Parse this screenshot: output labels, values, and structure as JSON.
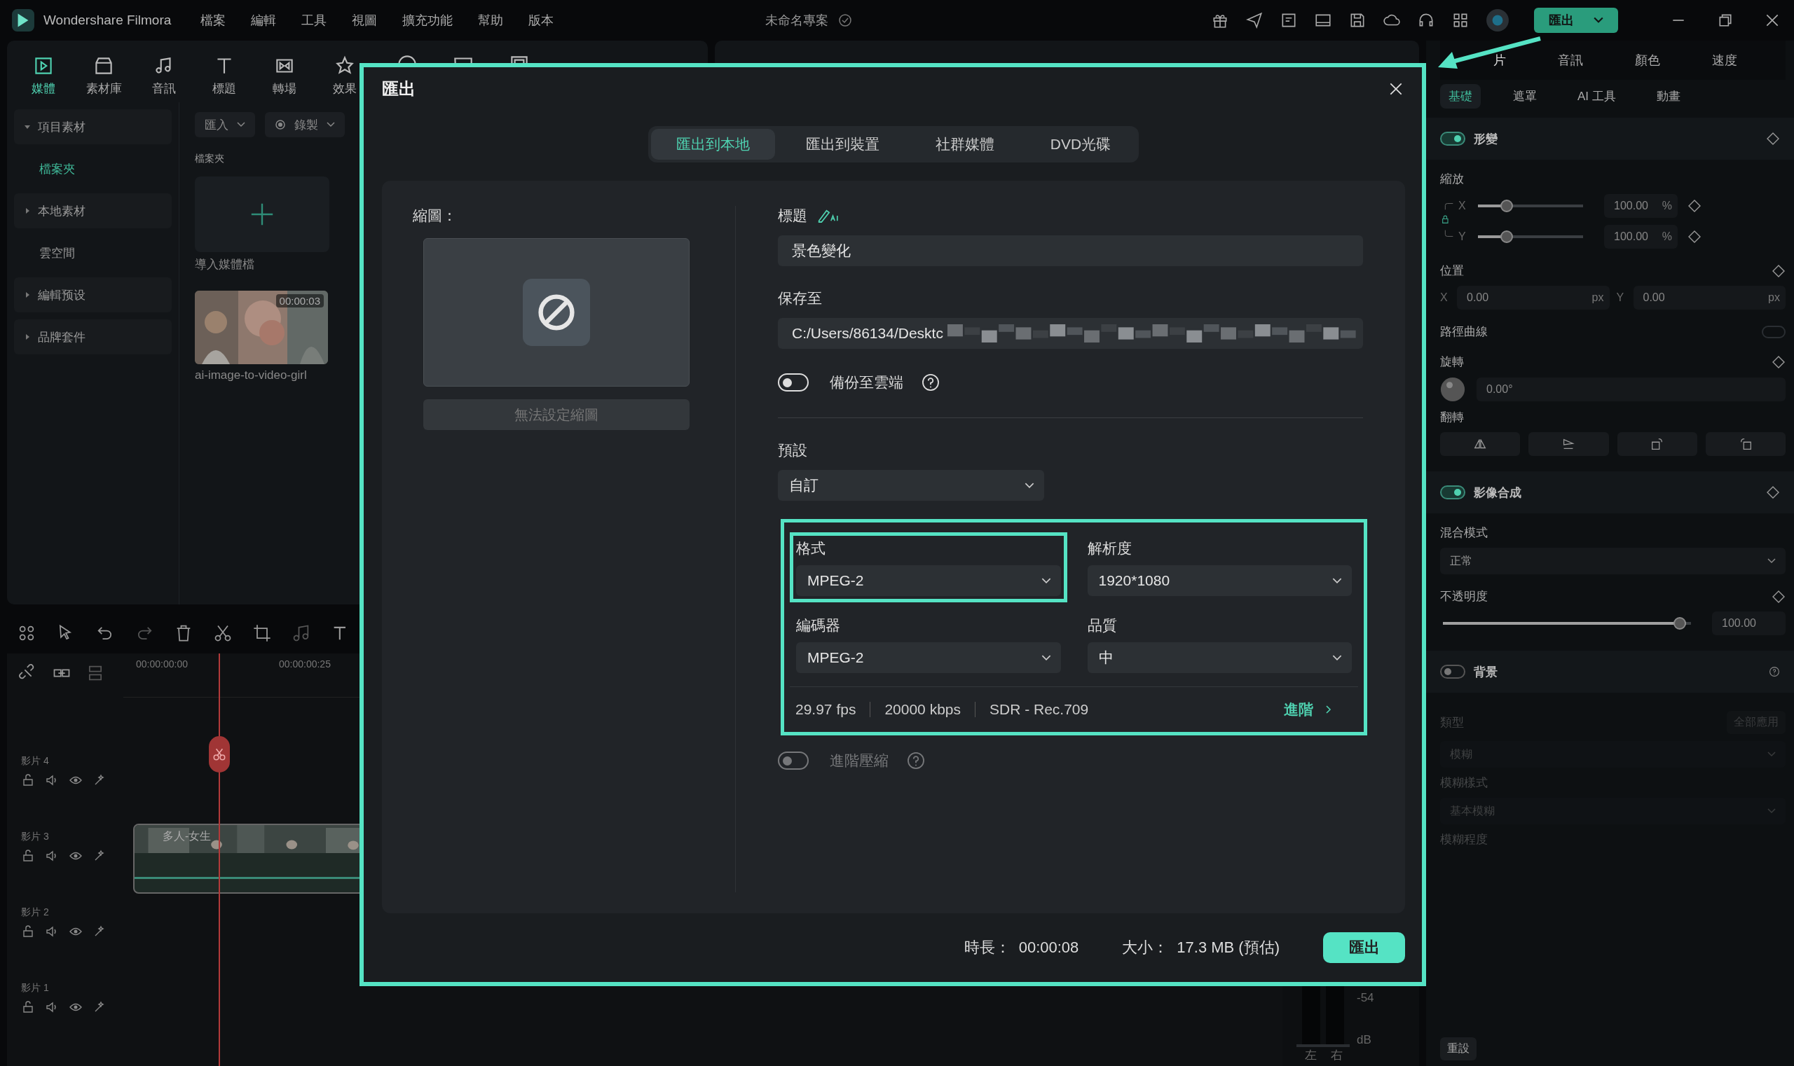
{
  "app": {
    "name": "Wondershare Filmora",
    "project_title": "未命名專案",
    "export_button": "匯出"
  },
  "menu": [
    "檔案",
    "編輯",
    "工具",
    "視圖",
    "擴充功能",
    "幫助",
    "版本"
  ],
  "toolbar": [
    {
      "label": "媒體",
      "selected": true
    },
    {
      "label": "素材庫",
      "selected": false
    },
    {
      "label": "音訊",
      "selected": false
    },
    {
      "label": "標題",
      "selected": false
    },
    {
      "label": "轉場",
      "selected": false
    },
    {
      "label": "效果",
      "selected": false
    }
  ],
  "media_nav": [
    {
      "label": "項目素材",
      "kind": "group",
      "expanded": true,
      "selected": false
    },
    {
      "label": "檔案夾",
      "kind": "leaf",
      "selected": true
    },
    {
      "label": "本地素材",
      "kind": "group",
      "expanded": false,
      "selected": false
    },
    {
      "label": "雲空間",
      "kind": "leaf",
      "selected": false
    },
    {
      "label": "編輯预设",
      "kind": "group",
      "expanded": false,
      "selected": false
    },
    {
      "label": "品牌套件",
      "kind": "group",
      "expanded": false,
      "selected": false
    }
  ],
  "media": {
    "import": "匯入",
    "record": "錄製",
    "folder_label": "檔案夾",
    "import_tile": "導入媒體檔",
    "clips": [
      {
        "name": "ai-image-to-video-girl",
        "duration": "00:00:03"
      }
    ]
  },
  "timeline": {
    "ruler": [
      "00:00:00:00",
      "00:00:00:25"
    ],
    "tracks": [
      {
        "name": "影片 4"
      },
      {
        "name": "影片 3",
        "clip": "多人-女生"
      },
      {
        "name": "影片 2"
      },
      {
        "name": "影片 1"
      }
    ]
  },
  "audio_meter": {
    "tick": "-54",
    "unit": "dB",
    "channels": [
      "左",
      "右"
    ]
  },
  "inspector": {
    "tabs": [
      {
        "label": "片",
        "selected": true
      },
      {
        "label": "音訊",
        "selected": false
      },
      {
        "label": "顏色",
        "selected": false
      },
      {
        "label": "速度",
        "selected": false
      }
    ],
    "subtabs": [
      {
        "label": "基礎",
        "selected": true
      },
      {
        "label": "遮罩",
        "selected": false
      },
      {
        "label": "AI 工具",
        "selected": false
      },
      {
        "label": "動畫",
        "selected": false
      }
    ],
    "transform": {
      "title": "形變",
      "on": true,
      "scale_label": "縮放",
      "scale": [
        {
          "axis": "X",
          "level": 0.27,
          "value": "100.00",
          "unit": "%"
        },
        {
          "axis": "Y",
          "level": 0.27,
          "value": "100.00",
          "unit": "%"
        }
      ],
      "position_label": "位置",
      "position": [
        {
          "axis": "X",
          "value": "0.00",
          "unit": "px"
        },
        {
          "axis": "Y",
          "value": "0.00",
          "unit": "px"
        }
      ],
      "path_curve": {
        "label": "路徑曲線",
        "on": false
      },
      "rotate_label": "旋轉",
      "rotate_value": "0.00°",
      "flip_label": "翻轉"
    },
    "compositing": {
      "title": "影像合成",
      "on": true,
      "blend_label": "混合模式",
      "blend_value": "正常",
      "opacity": {
        "label": "不透明度",
        "level": 0.98,
        "value": "100.00"
      }
    },
    "background": {
      "title": "背景",
      "on": false,
      "type_label": "類型",
      "apply_all": "全部應用",
      "type_value": "模糊",
      "style_label": "模糊樣式",
      "style_value": "基本模糊",
      "strength_label": "模糊程度"
    },
    "reset": "重設"
  },
  "dialog": {
    "title": "匯出",
    "tabs": [
      {
        "label": "匯出到本地",
        "selected": true
      },
      {
        "label": "匯出到裝置",
        "selected": false
      },
      {
        "label": "社群媒體",
        "selected": false
      },
      {
        "label": "DVD光碟",
        "selected": false
      }
    ],
    "thumbnail": {
      "label": "縮圖：",
      "button": "無法設定縮圖"
    },
    "title_label": "標題",
    "title_value": "景色變化",
    "save_label": "保存至",
    "save_path": "C:/Users/86134/Desktc",
    "backup": {
      "label": "備份至雲端",
      "on": false
    },
    "preset_label": "預設",
    "preset_value": "自訂",
    "settings": [
      {
        "label": "格式",
        "value": "MPEG-2",
        "highlighted": true
      },
      {
        "label": "解析度",
        "value": "1920*1080",
        "highlighted": false
      },
      {
        "label": "編碼器",
        "value": "MPEG-2",
        "highlighted": false
      },
      {
        "label": "品質",
        "value": "中",
        "highlighted": false
      }
    ],
    "info": [
      "29.97 fps",
      "20000 kbps",
      "SDR - Rec.709"
    ],
    "advanced": "進階",
    "compression": {
      "label": "進階壓縮",
      "on": false,
      "disabled": true
    },
    "duration_label": "時長：",
    "duration": "00:00:08",
    "size_label": "大小：",
    "size": "17.3 MB (預估)",
    "export_button": "匯出"
  }
}
